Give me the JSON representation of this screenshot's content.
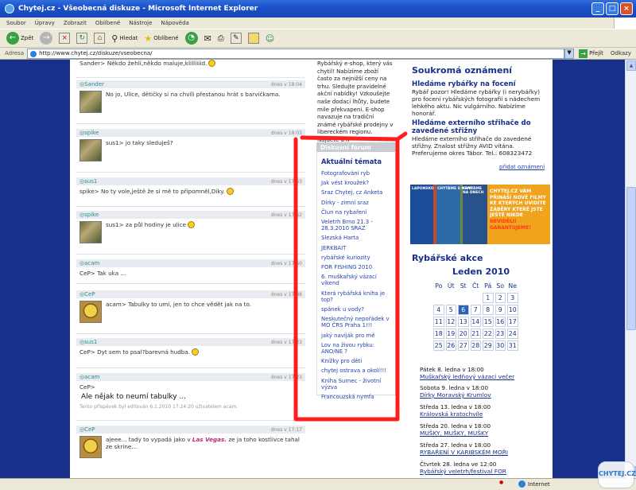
{
  "window": {
    "title": "Chytej.cz - Všeobecná diskuze - Microsoft Internet Explorer"
  },
  "menu": [
    "Soubor",
    "Úpravy",
    "Zobrazit",
    "Oblíbené",
    "Nástroje",
    "Nápověda"
  ],
  "toolbar": {
    "back": "Zpět",
    "search": "Hledat",
    "favorites": "Oblíbené"
  },
  "address": {
    "label": "Adresa",
    "url": "http://www.chytej.cz/diskuze/vseobecna/",
    "go": "Přejít",
    "links": "Odkazy"
  },
  "status": {
    "text": "",
    "zone": "Internet"
  },
  "posts": {
    "first_line": "Sander> Někdo žehlí,někdo maluje,klilliiiid.",
    "items": [
      {
        "author": "Sander",
        "date": "dnes v 18:04",
        "text": "No jo, Ulice, dětičky si na chvíli přestanou hrát s barvičkama."
      },
      {
        "author": "spike",
        "date": "dnes v 18:03",
        "text": "sus1> jo taky sleduješ?"
      },
      {
        "author": "sus1",
        "date": "dnes v 17:53",
        "text": "spike> No ty vole,ještě že si mě to připomněl,Díky."
      },
      {
        "author": "spike",
        "date": "dnes v 17:52",
        "text": "sus1> za půl hodiny je ulice"
      },
      {
        "author": "acam",
        "date": "dnes v 17:50",
        "text": "CeP> Tak uka ..."
      },
      {
        "author": "CeP",
        "date": "dnes v 17:38",
        "text": "acam> Tabulky to umí, jen to chce vědět jak na to."
      },
      {
        "author": "sus1",
        "date": "dnes v 17:23",
        "text": "CeP> Dyt sem to psal?barevná hudba."
      },
      {
        "author": "acam",
        "date": "dnes v 17:23",
        "text": "CeP>",
        "big": "Ale nějak to neumí tabulky ...",
        "edited": "Tento příspěvek byl editován 6.1.2010 17:24:20 uživatelem acam."
      },
      {
        "author": "CeP",
        "date": "dnes v 17:17",
        "text_a": "ajeee... tady to vypadá jako v",
        "text_b": "Las Vegas.",
        "text_c": "ze ja toho kostlivce tahal ze skrine..."
      }
    ]
  },
  "middle": {
    "ad": "Rybářský e-shop, který vás chytil! Nabízíme zboží často za nejnižší ceny na trhu. Sledujte pravidelné akční nabídky! Vzkoušejte naše dodací lhůty, budete mile překvapeni. E-shop navazuje na tradiční známé rybářské prodejny v libereckém regionu. Najdete u n",
    "forum": "Diskusní fórum",
    "topics_title": "Aktuální témata",
    "topics": [
      "Fotografování ryb",
      "Jak vést kroužek?",
      "Sraz Chytej. cz Anketa",
      "Dírky - zimní sraz",
      "Člun na rybaření",
      "Veletrh Brno 21.3 - 28.3.2010 SRAZ",
      "Slezská Harta",
      "JERKBAIT",
      "rybářské kuriozity",
      "FOR FISHING 2010",
      "6. muškařský vázací víkend",
      "Která rybářská kniha je top?",
      "spánek u vody?",
      "Neskutečný nepořádek v MO ČRS Praha 1!!!",
      "jaký naviják pro mě",
      "Lov na živou rybku: ANO/NE ?",
      "Knížky pro děti",
      "chytej ostrava a okolí!!!",
      "Kniha Surnec - životní výzva",
      "Francouzská nymfa"
    ]
  },
  "right": {
    "title": "Soukromá oznámení",
    "classifieds": [
      {
        "title": "Hledáme rybářky na focení",
        "text": "Rybář pozor! Hledáme rybářky (i nerybářky) pro focení rybářských fotografií s nádechem lehkého aktu. Nic vulgárního. Nabízíme honorář."
      },
      {
        "title": "Hledáme externího střihače do zavedené střižny",
        "text": "Hledáme externího střihače do zavedené střižny. Znalost střižny AVID vítána. Preferujeme okres Tábor. Tel.: 608323472"
      }
    ],
    "add_link": "přidat oznámení",
    "banner": {
      "dvd1": "LAPONSKO",
      "dvd2": "CHYTÁME S NÁMI",
      "dvd3": "CHYTÁME NA DNECH",
      "line1": "CHYTEJ.CZ VÁM PŘINÁŠÍ NOVÉ FILMY KE KTERÝCH UVIDÍTE ZÁBĚRY KTERÉ JSTE JEŠTĚ NIKDE",
      "line2": "NEVIDĚLI! GARANTUJEME!"
    },
    "events_title": "Rybářské akce",
    "month": "Leden 2010",
    "weekdays": [
      "Po",
      "Út",
      "St",
      "Čt",
      "Pá",
      "So",
      "Ne"
    ],
    "weeks": [
      [
        "",
        "",
        "",
        "",
        "1",
        "2",
        "3"
      ],
      [
        "4",
        "5",
        "6",
        "7",
        "8",
        "9",
        "10"
      ],
      [
        "11",
        "12",
        "13",
        "14",
        "15",
        "16",
        "17"
      ],
      [
        "18",
        "19",
        "20",
        "21",
        "22",
        "23",
        "24"
      ],
      [
        "25",
        "26",
        "27",
        "28",
        "29",
        "30",
        "31"
      ]
    ],
    "today": "6",
    "events": [
      {
        "date": "Pátek 8. ledna v 18:00",
        "name": "Muškařský ledňový vázací večer"
      },
      {
        "date": "Sobota 9. ledna v 18:00",
        "name": "Dírky Moravský Krumlov"
      },
      {
        "date": "Středa 13. ledna v 18:00",
        "name": "Královská kratochvíle"
      },
      {
        "date": "Středa 20. ledna v 18:00",
        "name": "MUŠKY, MUŠKY, MUŠKY"
      },
      {
        "date": "Středa 27. ledna v 18:00",
        "name": "RYBAŘENÍ V KARIBSKÉM MOŘI"
      },
      {
        "date": "Čtvrtek 28. ledna ve 12:00",
        "name": "Rybářský veletrh/festival FOR"
      }
    ]
  },
  "watermark": "CHYTEJ.CZ"
}
